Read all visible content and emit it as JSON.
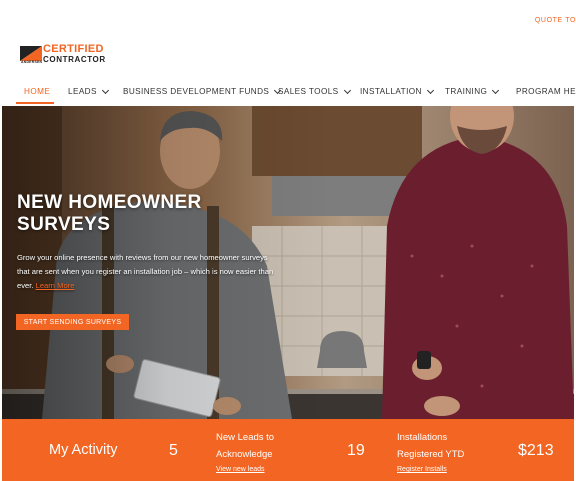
{
  "header": {
    "quote_link": "QUOTE TO"
  },
  "logo": {
    "line1": "CERTIFIED",
    "line2": "CONTRACTOR",
    "brand": "ANDERSEN"
  },
  "nav": {
    "items": [
      {
        "label": "HOME",
        "active": true
      },
      {
        "label": "LEADS"
      },
      {
        "label": "BUSINESS DEVELOPMENT FUNDS"
      },
      {
        "label": "SALES TOOLS"
      },
      {
        "label": "INSTALLATION"
      },
      {
        "label": "TRAINING"
      },
      {
        "label": "PROGRAM HELP"
      }
    ]
  },
  "hero": {
    "title": "NEW HOMEOWNER SURVEYS",
    "description": "Grow your online presence with reviews from our new homeowner surveys that are sent when you register an installation job – which is now easier than ever.",
    "link": "Learn More",
    "button": "START SENDING SURVEYS"
  },
  "activity": {
    "title": "My Activity",
    "stats": [
      {
        "value": "5",
        "label_lines": [
          "New Leads to",
          "Acknowledge"
        ],
        "link": "View new leads"
      },
      {
        "value": "19",
        "label_lines": [
          "Installations",
          "Registered YTD"
        ],
        "link": "Register Installs"
      },
      {
        "value": "$213"
      }
    ]
  },
  "colors": {
    "accent": "#f26522"
  }
}
